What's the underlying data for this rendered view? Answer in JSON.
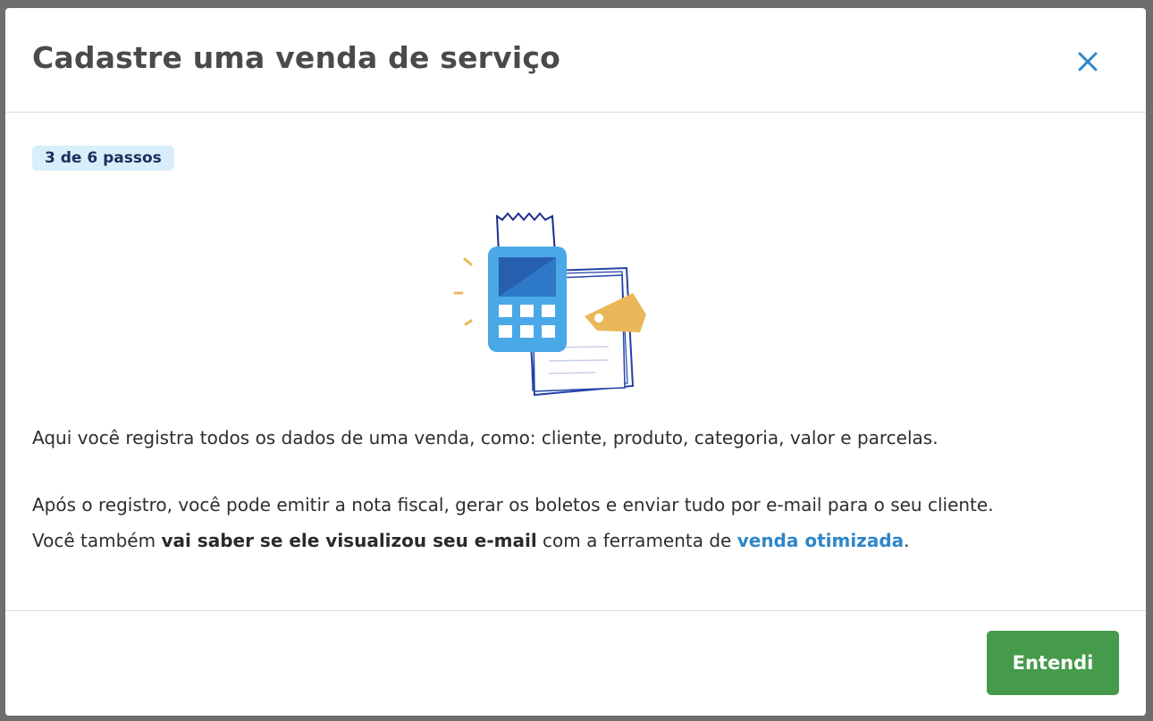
{
  "modal": {
    "title": "Cadastre uma venda de serviço",
    "step_badge": "3 de 6 passos",
    "paragraph1": "Aqui você registra todos os dados de uma venda, como: cliente, produto, categoria, valor e parcelas.",
    "paragraph2": "Após o registro, você pode emitir a nota fiscal, gerar os boletos e enviar tudo por e-mail para o seu cliente.",
    "paragraph3": {
      "prefix": "Você também ",
      "bold": "vai saber se ele visualizou seu e-mail",
      "middle": " com a ferramenta de ",
      "link": "venda otimizada",
      "suffix": "."
    },
    "confirm_button": "Entendi"
  },
  "icons": {
    "close": "close-icon",
    "illustration": "payment-terminal-receipt-illustration"
  },
  "colors": {
    "accent_blue": "#2f86c9",
    "badge_bg": "#d9eefb",
    "badge_text": "#1b2f5c",
    "button_green": "#469a4b",
    "title_gray": "#4a4a4a",
    "overlay": "#6e6e6e"
  }
}
